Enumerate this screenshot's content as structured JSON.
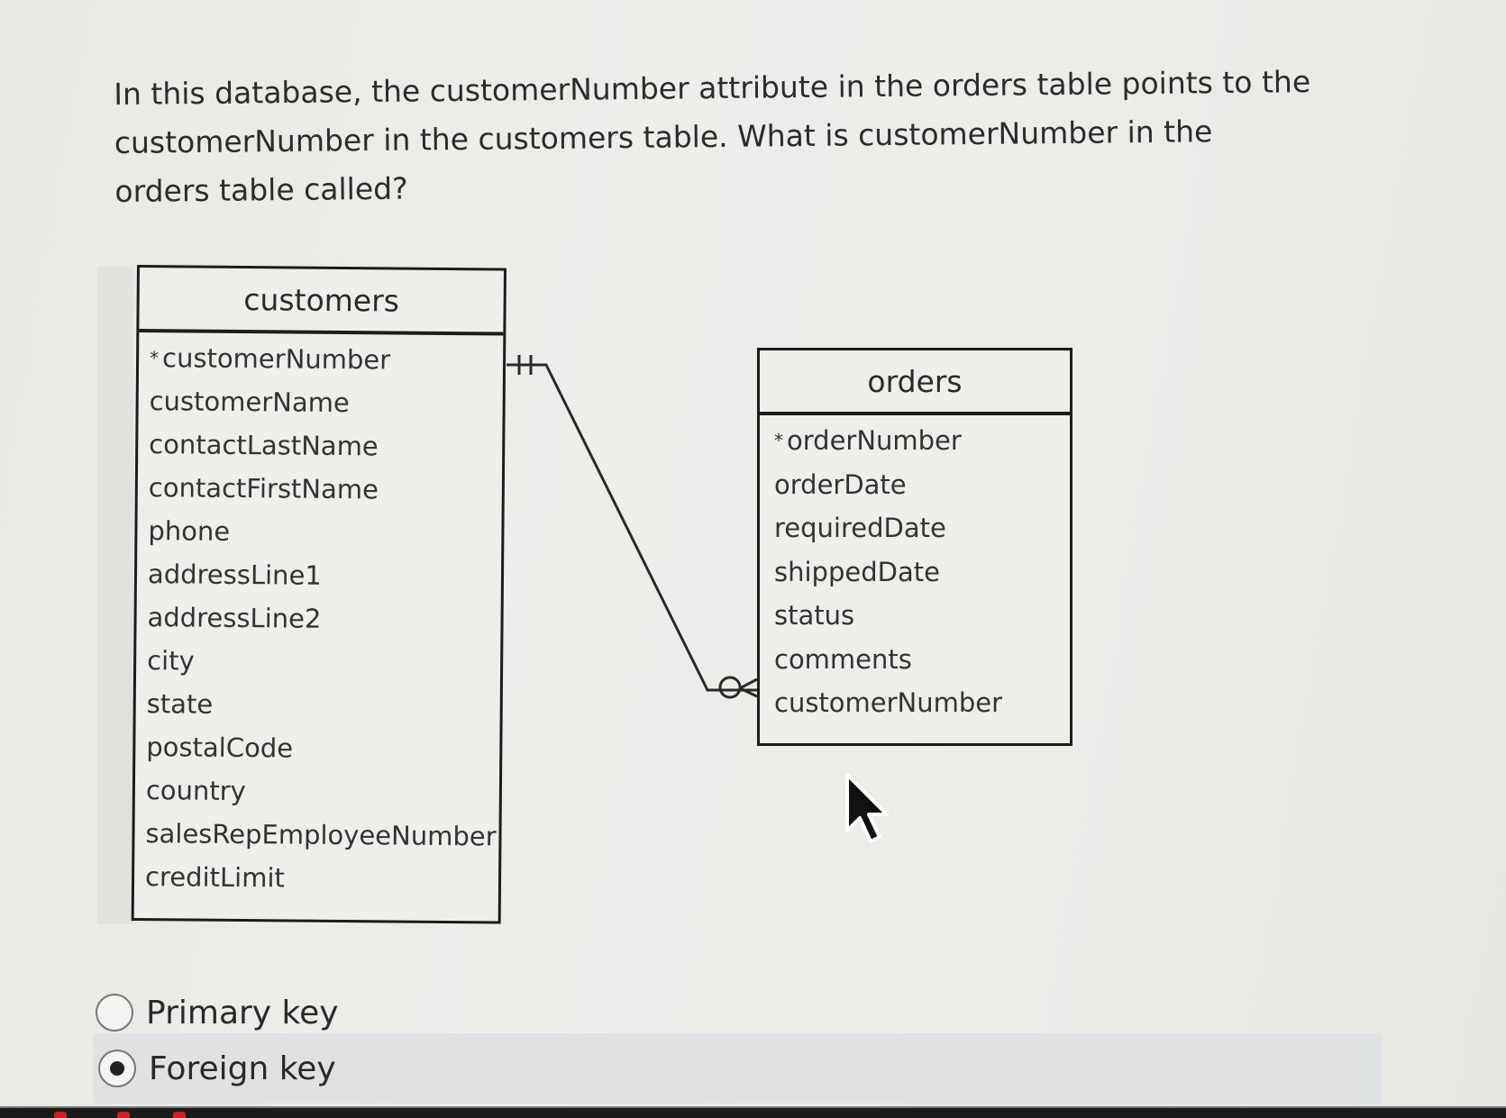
{
  "question": {
    "text": "In this database, the customerNumber attribute in the orders table points to the customerNumber in the customers table. What is customerNumber in the orders table called?"
  },
  "diagram": {
    "customers": {
      "title": "customers",
      "primary_key_marker": "*",
      "fields": [
        {
          "name": "customerNumber",
          "pk": true
        },
        {
          "name": "customerName",
          "pk": false
        },
        {
          "name": "contactLastName",
          "pk": false
        },
        {
          "name": "contactFirstName",
          "pk": false
        },
        {
          "name": "phone",
          "pk": false
        },
        {
          "name": "addressLine1",
          "pk": false
        },
        {
          "name": "addressLine2",
          "pk": false
        },
        {
          "name": "city",
          "pk": false
        },
        {
          "name": "state",
          "pk": false
        },
        {
          "name": "postalCode",
          "pk": false
        },
        {
          "name": "country",
          "pk": false
        },
        {
          "name": "salesRepEmployeeNumber",
          "pk": false
        },
        {
          "name": "creditLimit",
          "pk": false
        }
      ]
    },
    "orders": {
      "title": "orders",
      "primary_key_marker": "*",
      "fields": [
        {
          "name": "orderNumber",
          "pk": true
        },
        {
          "name": "orderDate",
          "pk": false
        },
        {
          "name": "requiredDate",
          "pk": false
        },
        {
          "name": "shippedDate",
          "pk": false
        },
        {
          "name": "status",
          "pk": false
        },
        {
          "name": "comments",
          "pk": false
        },
        {
          "name": "customerNumber",
          "pk": false
        }
      ]
    },
    "relationship": {
      "from": "customers.customerNumber",
      "to": "orders.customerNumber",
      "from_cardinality": "one-and-only-one",
      "to_cardinality": "zero-or-many"
    }
  },
  "answer_options": [
    {
      "label": "Primary key",
      "selected": false
    },
    {
      "label": "Foreign key",
      "selected": true
    }
  ],
  "cursor": {
    "icon": "arrow-cursor-icon"
  }
}
